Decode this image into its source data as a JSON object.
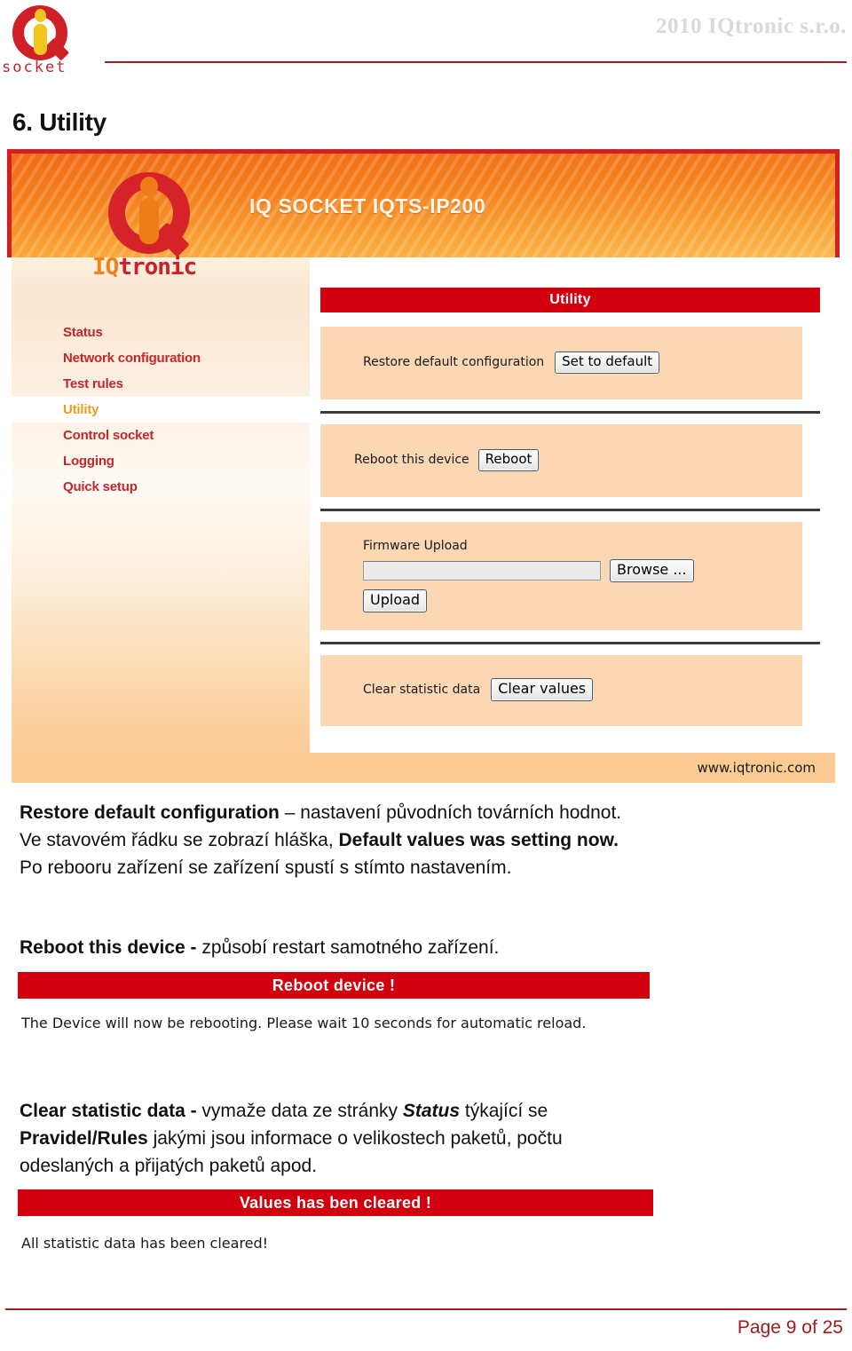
{
  "doc_header": {
    "copyright": "2010 IQtronic  s.r.o.",
    "brand_word": "socket"
  },
  "page_title": "6. Utility",
  "screenshot": {
    "banner_title": "IQ SOCKET    IQTS-IP200",
    "logo_word_hl": "IQ",
    "logo_word_rest": "tronic",
    "nav": [
      {
        "label": "Status",
        "active": false
      },
      {
        "label": "Network configuration",
        "active": false
      },
      {
        "label": "Test rules",
        "active": false
      },
      {
        "label": "Utility",
        "active": true
      },
      {
        "label": "Control socket",
        "active": false
      },
      {
        "label": "Logging",
        "active": false
      },
      {
        "label": "Quick setup",
        "active": false
      }
    ],
    "main_title": "Utility",
    "rows": {
      "restore_label": "Restore default configuration",
      "restore_button": "Set to default",
      "reboot_label": "Reboot this device",
      "reboot_button": "Reboot",
      "firmware_label": "Firmware Upload",
      "firmware_field_value": "",
      "browse_button": "Browse ...",
      "upload_button": "Upload",
      "clear_label": "Clear statistic data",
      "clear_button": "Clear values"
    },
    "footer_url": "www.iqtronic.com"
  },
  "prose": {
    "restore_term": "Restore default configuration",
    "restore_text_1": " – nastavení původních továrních hodnot.",
    "restore_text_2": "Ve stavovém řádku se zobrazí hláška, ",
    "restore_bold_2": "Default values was setting now.",
    "restore_text_3": "Po rebooru zařízení se zařízení spustí s stímto nastavením.",
    "reboot_term": "Reboot this device - ",
    "reboot_text": "způsobí restart samotného zařízení.",
    "reboot_alert": "Reboot device !",
    "reboot_alert_msg": "The Device will now be rebooting. Please wait 10 seconds for automatic reload.",
    "clear_term": "Clear statistic data - ",
    "clear_text_1": " vymaže data ze stránky ",
    "clear_em_1": "Status",
    "clear_text_2": " týkající se",
    "clear_bold_2": "Pravidel/Rules",
    "clear_text_3": " jakými jsou  informace o velikostech paketů, počtu",
    "clear_text_4": "odeslaných a přijatých paketů apod.",
    "clear_alert": "Values has ben cleared !",
    "clear_alert_msg": "All statistic data has been cleared!"
  },
  "footer": {
    "page_number": "Page 9 of 25"
  }
}
